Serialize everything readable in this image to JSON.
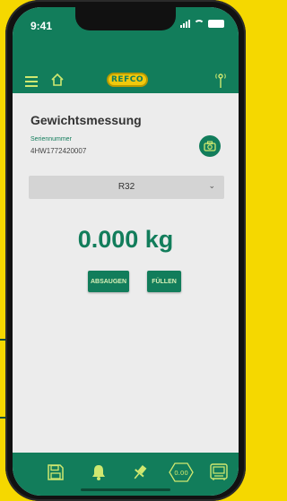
{
  "status_bar": {
    "time": "9:41"
  },
  "header": {
    "logo_text": "REFCO"
  },
  "main": {
    "title": "Gewichtsmessung",
    "serial_label": "Seriennummer",
    "serial_number": "4HW1772420007",
    "refrigerant": {
      "selected": "R32"
    },
    "weight": "0.000 kg",
    "buttons": {
      "absaugen": "ABSAUGEN",
      "fullen": "FÜLLEN"
    }
  },
  "bottom_nav": {
    "items": [
      {
        "icon": "save-icon"
      },
      {
        "icon": "bell-icon"
      },
      {
        "icon": "pin-icon"
      },
      {
        "icon": "tare-icon",
        "label": "0.00"
      },
      {
        "icon": "device-icon"
      }
    ]
  },
  "colors": {
    "accent": "#127d5b",
    "background_frame": "#f5d800",
    "logo": "#f2c90c"
  }
}
